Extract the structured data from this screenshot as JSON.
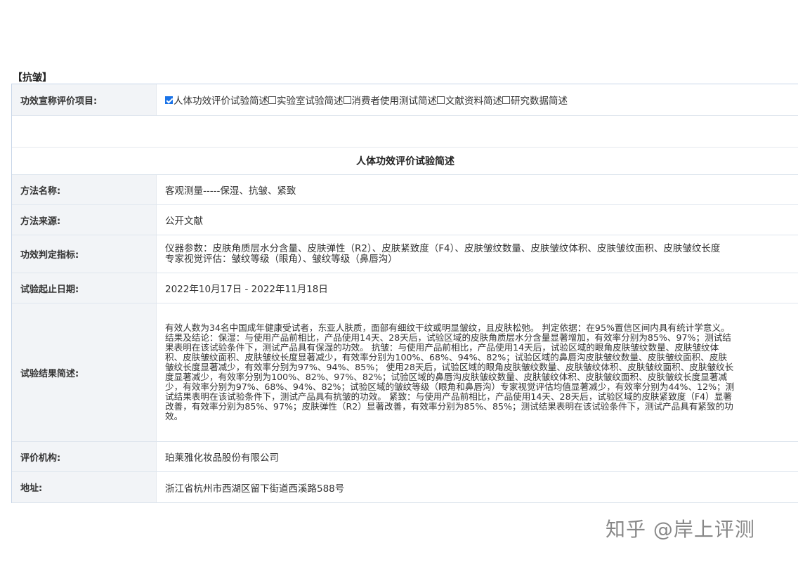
{
  "section_title": "【抗皱】",
  "claim": {
    "label": "功效宣称评价项目:",
    "options": [
      {
        "text": "人体功效评价试验简述",
        "checked": true
      },
      {
        "text": "实验室试验简述",
        "checked": false
      },
      {
        "text": "消费者使用测试简述",
        "checked": false
      },
      {
        "text": "文献资料简述",
        "checked": false
      },
      {
        "text": "研究数据简述",
        "checked": false
      }
    ]
  },
  "subheader": "人体功效评价试验简述",
  "rows": {
    "method_name": {
      "label": "方法名称:",
      "value": "客观测量-----保湿、抗皱、紧致"
    },
    "method_source": {
      "label": "方法来源:",
      "value": "公开文献"
    },
    "indicators": {
      "label": "功效判定指标:",
      "value": "仪器参数：皮肤角质层水分含量、皮肤弹性（R2）、皮肤紧致度（F4）、皮肤皱纹数量、皮肤皱纹体积、皮肤皱纹面积、皮肤皱纹长度 专家视觉评估：皱纹等级（眼角）、皱纹等级（鼻唇沟）"
    },
    "dates": {
      "label": "试验起止日期:",
      "value": "2022年10月17日 - 2022年11月18日"
    },
    "results": {
      "label": "试验结果简述:",
      "value": "有效人数为34名中国成年健康受试者，东亚人肤质，面部有细纹干纹或明显皱纹，且皮肤松弛。 判定依据：在95%置信区间内具有统计学意义。 结果及结论：保湿：与使用产品前相比，产品使用14天、28天后，试验区域的皮肤角质层水分含量显著增加，有效率分别为85%、97%；测试结果表明在该试验条件下，测试产品具有保湿的功效。 抗皱：与使用产品前相比，产品使用14天后，试验区域的眼角皮肤皱纹数量、皮肤皱纹体积、皮肤皱纹面积、皮肤皱纹长度显著减少，有效率分别为100%、68%、94%、82%；试验区域的鼻唇沟皮肤皱纹数量、皮肤皱纹面积、皮肤皱纹长度显著减少，有效率分别为97%、94%、85%； 使用28天后，试验区域的眼角皮肤皱纹数量、皮肤皱纹体积、皮肤皱纹面积、皮肤皱纹长度显著减少，有效率分别为100%、82%、97%、82%；试验区域的鼻唇沟皮肤皱纹数量、皮肤皱纹体积、皮肤皱纹面积、皮肤皱纹长度显著减少，有效率分别为97%、68%、94%、82%；试验区域的皱纹等级（眼角和鼻唇沟）专家视觉评估均值显著减少，有效率分别为44%、12%；测试结果表明在该试验条件下，测试产品具有抗皱的功效。 紧致：与使用产品前相比，产品使用14天、28天后，试验区域的皮肤紧致度（F4）显著改善，有效率分别为85%、97%；皮肤弹性（R2）显著改善，有效率分别为85%、85%；测试结果表明在该试验条件下，测试产品具有紧致的功效。"
    },
    "institution": {
      "label": "评价机构:",
      "value": "珀莱雅化妆品股份有限公司"
    },
    "address": {
      "label": "地址:",
      "value": "浙江省杭州市西湖区留下街道西溪路588号"
    }
  },
  "watermark": "知乎 @岸上评测",
  "colors": {
    "checkbox_checked": "#1a73e8",
    "label_bg": "#f2f4f7",
    "border": "#c8d6e8"
  }
}
